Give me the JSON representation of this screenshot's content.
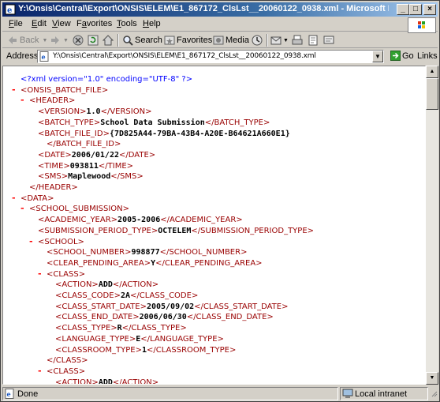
{
  "window": {
    "title": "Y:\\Onsis\\Central\\Export\\ONSIS\\ELEM\\E1_867172_ClsLst__20060122_0938.xml - Microsoft Internet Expl..."
  },
  "menu": {
    "items": [
      {
        "label": "File",
        "key": "F"
      },
      {
        "label": "Edit",
        "key": "E"
      },
      {
        "label": "View",
        "key": "V"
      },
      {
        "label": "Favorites",
        "key": "a"
      },
      {
        "label": "Tools",
        "key": "T"
      },
      {
        "label": "Help",
        "key": "H"
      }
    ]
  },
  "toolbar": {
    "back_label": "Back",
    "search_label": "Search",
    "favorites_label": "Favorites",
    "media_label": "Media"
  },
  "address": {
    "label": "Address",
    "value": "Y:\\Onsis\\Central\\Export\\ONSIS\\ELEM\\E1_867172_ClsLst__20060122_0938.xml",
    "go_label": "Go",
    "links_label": "Links"
  },
  "xml": {
    "declaration": "<?xml version=\"1.0\" encoding=\"UTF-8\" ?>",
    "lines": [
      {
        "open": "<ONSIS_BATCH_FILE>",
        "value": "",
        "close": "",
        "collapsible": true
      },
      {
        "open": "<HEADER>",
        "value": "",
        "close": "",
        "collapsible": true
      },
      {
        "open": "<VERSION>",
        "value": "1.0",
        "close": "</VERSION>"
      },
      {
        "open": "<BATCH_TYPE>",
        "value": "School Data Submission",
        "close": "</BATCH_TYPE>"
      },
      {
        "open": "<BATCH_FILE_ID>",
        "value": "{7D825A44-79BA-43B4-A20E-B64621A660E1}",
        "close": ""
      },
      {
        "open": "",
        "value": "",
        "close": "</BATCH_FILE_ID>"
      },
      {
        "open": "<DATE>",
        "value": "2006/01/22",
        "close": "</DATE>"
      },
      {
        "open": "<TIME>",
        "value": "093811",
        "close": "</TIME>"
      },
      {
        "open": "<SMS>",
        "value": "Maplewood",
        "close": "</SMS>"
      },
      {
        "open": "",
        "value": "",
        "close": "</HEADER>"
      },
      {
        "open": "<DATA>",
        "value": "",
        "close": "",
        "collapsible": true
      },
      {
        "open": "<SCHOOL_SUBMISSION>",
        "value": "",
        "close": "",
        "collapsible": true
      },
      {
        "open": "<ACADEMIC_YEAR>",
        "value": "2005-2006",
        "close": "</ACADEMIC_YEAR>"
      },
      {
        "open": "<SUBMISSION_PERIOD_TYPE>",
        "value": "OCTELEM",
        "close": "</SUBMISSION_PERIOD_TYPE>"
      },
      {
        "open": "<SCHOOL>",
        "value": "",
        "close": "",
        "collapsible": true
      },
      {
        "open": "<SCHOOL_NUMBER>",
        "value": "998877",
        "close": "</SCHOOL_NUMBER>"
      },
      {
        "open": "<CLEAR_PENDING_AREA>",
        "value": "Y",
        "close": "</CLEAR_PENDING_AREA>"
      },
      {
        "open": "<CLASS>",
        "value": "",
        "close": "",
        "collapsible": true
      },
      {
        "open": "<ACTION>",
        "value": "ADD",
        "close": "</ACTION>"
      },
      {
        "open": "<CLASS_CODE>",
        "value": "2A",
        "close": "</CLASS_CODE>"
      },
      {
        "open": "<CLASS_START_DATE>",
        "value": "2005/09/02",
        "close": "</CLASS_START_DATE>"
      },
      {
        "open": "<CLASS_END_DATE>",
        "value": "2006/06/30",
        "close": "</CLASS_END_DATE>"
      },
      {
        "open": "<CLASS_TYPE>",
        "value": "R",
        "close": "</CLASS_TYPE>"
      },
      {
        "open": "<LANGUAGE_TYPE>",
        "value": "E",
        "close": "</LANGUAGE_TYPE>"
      },
      {
        "open": "<CLASSROOM_TYPE>",
        "value": "1",
        "close": "</CLASSROOM_TYPE>"
      },
      {
        "open": "",
        "value": "",
        "close": "</CLASS>"
      },
      {
        "open": "<CLASS>",
        "value": "",
        "close": "",
        "collapsible": true
      },
      {
        "open": "<ACTION>",
        "value": "ADD",
        "close": "</ACTION>"
      }
    ]
  },
  "status": {
    "text": "Done",
    "zone": "Local intranet"
  }
}
